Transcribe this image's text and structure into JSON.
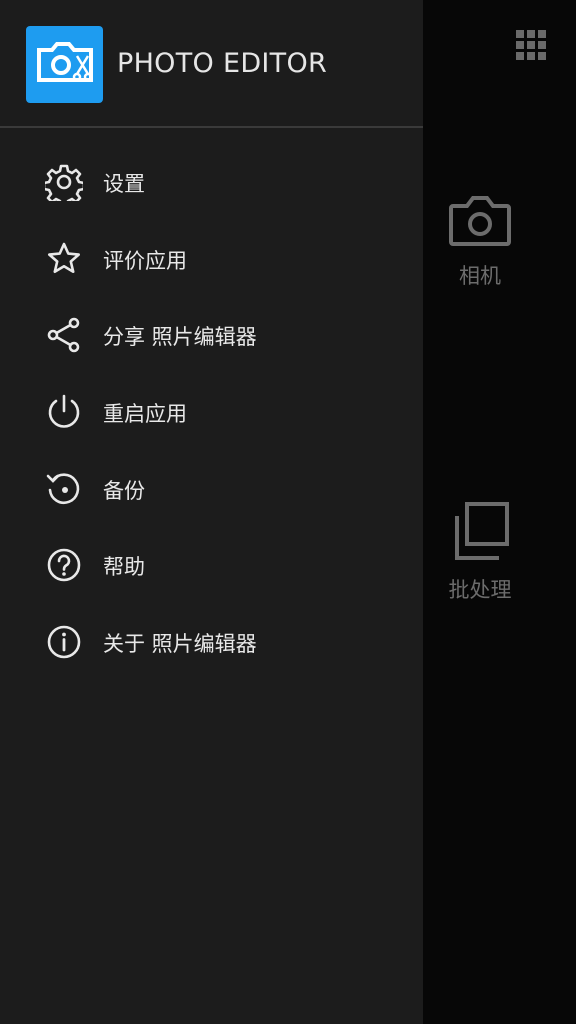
{
  "app": {
    "title": "PHOTO EDITOR"
  },
  "drawer": {
    "items": [
      {
        "label": "设置",
        "icon": "gear-icon"
      },
      {
        "label": "评价应用",
        "icon": "star-icon"
      },
      {
        "label": "分享 照片编辑器",
        "icon": "share-icon"
      },
      {
        "label": "重启应用",
        "icon": "power-icon"
      },
      {
        "label": "备份",
        "icon": "restore-icon"
      },
      {
        "label": "帮助",
        "icon": "help-icon"
      },
      {
        "label": "关于 照片编辑器",
        "icon": "info-icon"
      }
    ]
  },
  "main": {
    "tiles": [
      {
        "label": "相机",
        "icon": "camera-icon"
      },
      {
        "label": "批处理",
        "icon": "batch-icon"
      }
    ]
  },
  "colors": {
    "accent": "#1e9cf0",
    "drawer_bg": "#1c1c1c",
    "text": "#e8e8e8",
    "muted": "#6c6c6c"
  }
}
